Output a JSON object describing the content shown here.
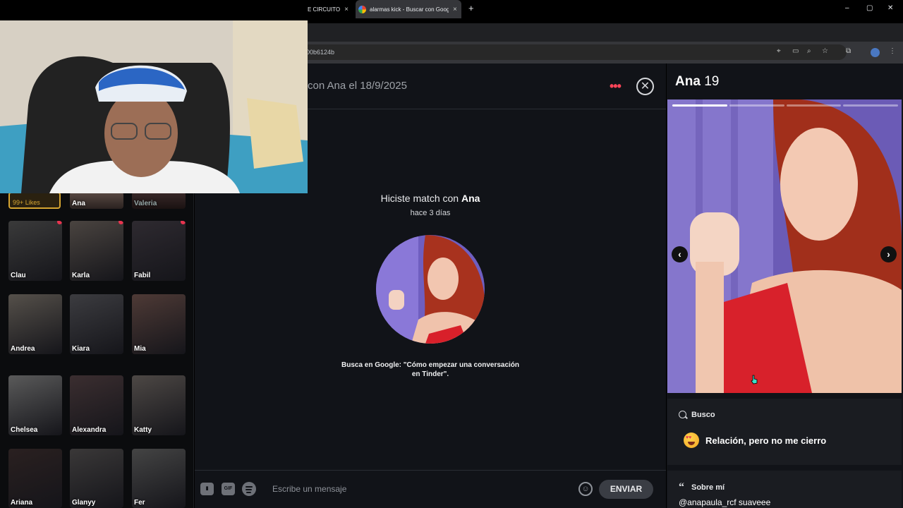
{
  "browser": {
    "tabs": [
      {
        "title": "E CIRCUITO",
        "close": "×"
      },
      {
        "title": "alarmas kick - Buscar con Goog",
        "close": "×"
      }
    ],
    "new_tab": "+",
    "url_fragment": "00b6124b",
    "window_controls": {
      "minimize": "–",
      "maximize": "▢",
      "close": "✕"
    }
  },
  "sidebar": {
    "likes_label": "99+ Likes",
    "top_row": [
      "Ana",
      "Valeria"
    ],
    "matches": [
      {
        "name": "Clau",
        "unread": true
      },
      {
        "name": "Karla",
        "unread": true
      },
      {
        "name": "Fabil",
        "unread": true
      },
      {
        "name": "Andrea",
        "unread": false
      },
      {
        "name": "Kiara",
        "unread": false
      },
      {
        "name": "Mia",
        "unread": false
      },
      {
        "name": "Chelsea",
        "unread": false
      },
      {
        "name": "Alexandra",
        "unread": false
      },
      {
        "name": "Katty",
        "unread": false
      },
      {
        "name": "Ariana",
        "unread": false
      },
      {
        "name": "Glanyy",
        "unread": false
      },
      {
        "name": "Fer",
        "unread": false
      }
    ]
  },
  "chat": {
    "header_title": "con Ana el 18/9/2025",
    "more_icon": "•••",
    "close_icon": "✕",
    "match_prefix": "Hiciste match con",
    "match_name": "Ana",
    "match_time": "hace 3 días",
    "hint": "Busca en Google: \"Cómo empezar una conversación en Tinder\".",
    "composer": {
      "gif_label": "GIF",
      "placeholder": "Escribe un mensaje",
      "send_label": "ENVIAR"
    }
  },
  "profile": {
    "name": "Ana",
    "age": "19",
    "photo_count": 4,
    "active_photo": 1,
    "prev_arrow": "‹",
    "next_arrow": "›",
    "busco_label": "Busco",
    "busco_value": "Relación, pero no me cierro",
    "about_label": "Sobre mí",
    "about_value": "@anapaula_rcf suaveee"
  },
  "colors": {
    "accent": "#ff4458",
    "likes_gold": "#d6a531",
    "background": "#111318"
  }
}
